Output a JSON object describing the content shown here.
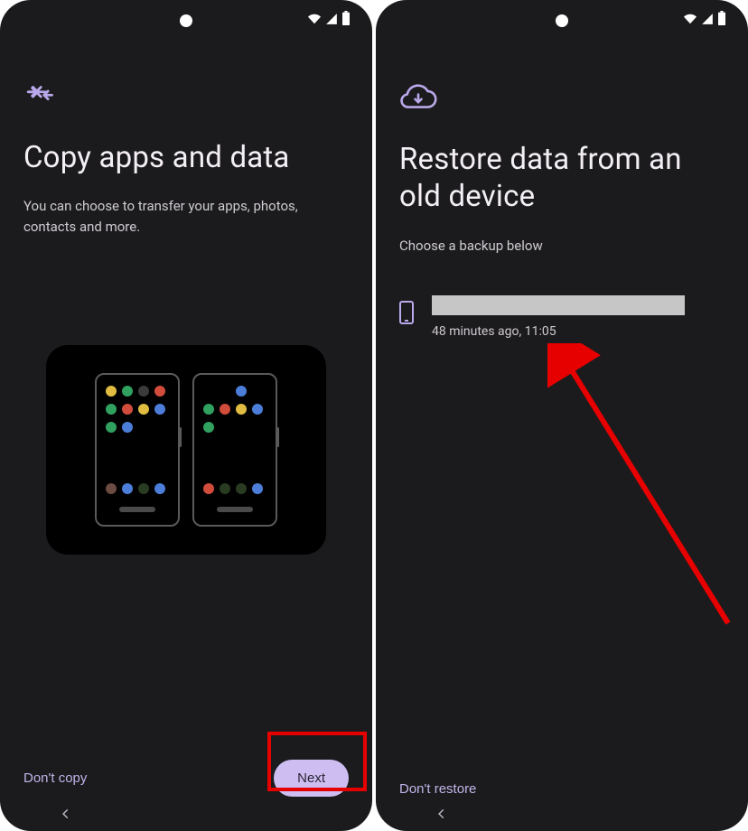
{
  "left": {
    "title": "Copy apps and data",
    "subtitle": "You can choose to transfer your apps, photos, contacts and more.",
    "dont_copy": "Don't copy",
    "next": "Next",
    "illustration": {
      "phone_a_dots_top": [
        "#e0bd41",
        "#31a15f",
        "#3b3b3b",
        "#d24c3c",
        "#31a15f",
        "#d24c3c",
        "#e0bd41",
        "#4c7ed9",
        "#31a15f",
        "#4c7ed9"
      ],
      "phone_a_dots_bottom": [
        "#6b4b42",
        "#4c7ed9",
        "#293c22",
        "#4c7ed9"
      ],
      "phone_b_dots_top": [
        "",
        "",
        "#4c7ed9",
        "",
        "#31a15f",
        "#d24c3c",
        "#e0bd41",
        "#4c7ed9",
        "#31a15f"
      ],
      "phone_b_dots_bottom": [
        "#d24c3c",
        "#293c22",
        "#293c22",
        "#4c7ed9"
      ]
    }
  },
  "right": {
    "title": "Restore data from an old device",
    "subtitle": "Choose a backup below",
    "backup": {
      "timestamp": "48 minutes ago, 11:05"
    },
    "dont_restore": "Don't restore"
  },
  "colors": {
    "accent": "#b9a8ea",
    "pill": "#cdbdf0"
  },
  "annotations": {
    "highlight": "next-button",
    "arrow_target": "backup-row"
  }
}
